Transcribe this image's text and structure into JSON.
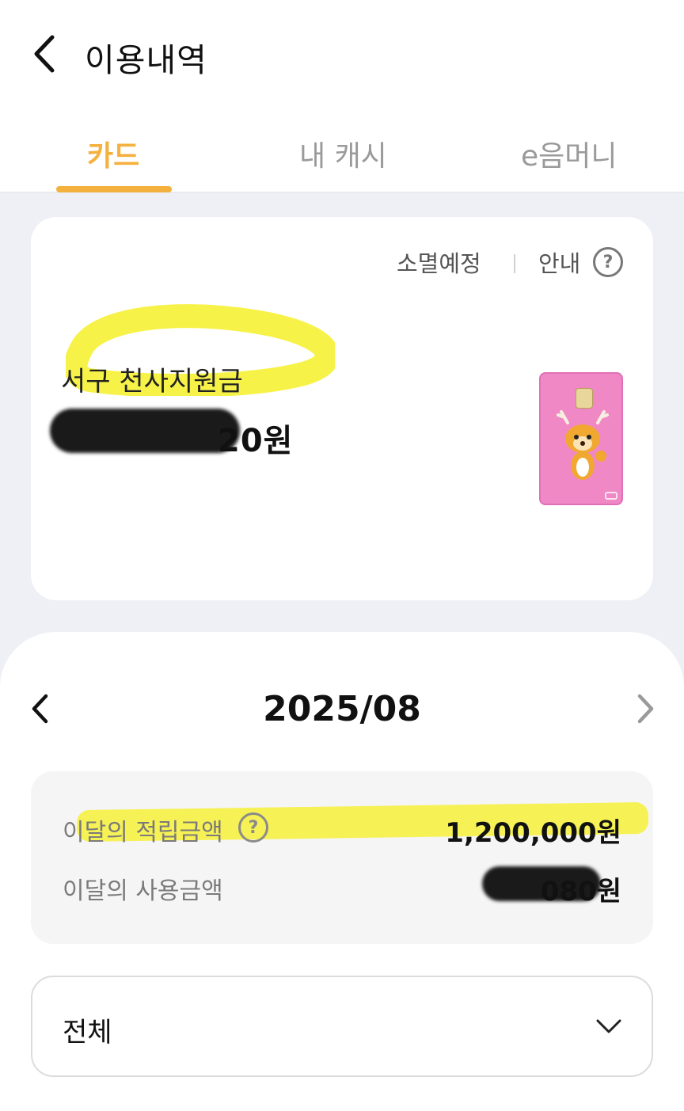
{
  "header": {
    "title": "이용내역"
  },
  "tabs": [
    {
      "label": "카드",
      "active": true
    },
    {
      "label": "내 캐시",
      "active": false
    },
    {
      "label": "e음머니",
      "active": false
    }
  ],
  "balance_card": {
    "expire_label": "소멸예정",
    "info_label": "안내",
    "help_icon_text": "?",
    "card_label": "서구 천사지원금",
    "amount_visible": "20원",
    "card_icon": "pink-card-with-deer-mascot-icon"
  },
  "month_nav": {
    "label": "2025/08"
  },
  "summary": {
    "accumulated_label": "이달의 적립금액",
    "accumulated_help": "?",
    "accumulated_value": "1,200,000원",
    "used_label": "이달의 사용금액",
    "used_value_visible": "080원"
  },
  "filter": {
    "selected": "전체"
  },
  "colors": {
    "accent": "#f4b13d",
    "background_gray": "#eef0f5",
    "card_pink": "#f088c6",
    "highlight_yellow": "#f6f028"
  }
}
